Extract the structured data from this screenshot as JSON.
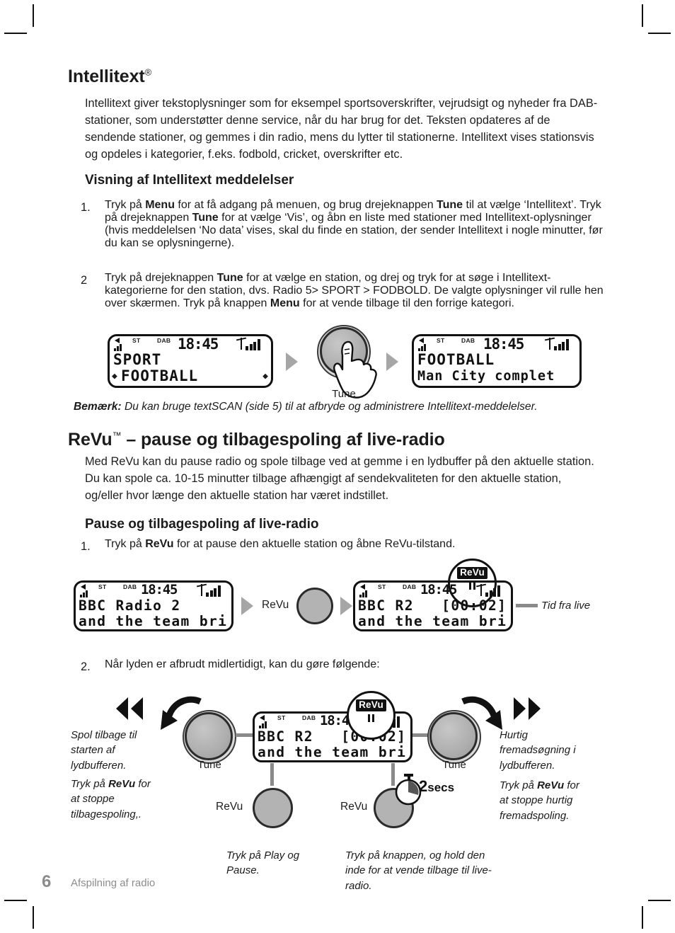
{
  "section1": {
    "title": "Intellitext",
    "title_sup": "®",
    "intro": "Intellitext giver tekstoplysninger som for eksempel sportsoverskrifter, vejrudsigt og nyheder fra DAB-stationer, som understøtter denne service, når du har brug for det. Teksten opdateres af de sendende stationer, og gemmes i din radio, mens du lytter til stationerne. Intellitext vises stationsvis og opdeles i kategorier, f.eks. fodbold, cricket, overskrifter etc.",
    "subtitle": "Visning af Intellitext meddelelser",
    "steps": [
      {
        "num": "1.",
        "parts": [
          {
            "t": "Tryk på ",
            "b": false
          },
          {
            "t": "Menu",
            "b": true
          },
          {
            "t": " for at få adgang på menuen, og brug drejeknappen ",
            "b": false
          },
          {
            "t": "Tune",
            "b": true
          },
          {
            "t": " til at vælge ‘Intellitext’. Tryk på drejeknappen ",
            "b": false
          },
          {
            "t": "Tune",
            "b": true
          },
          {
            "t": " for at vælge ‘Vis’, og åbn en liste med stationer med Intellitext-oplysninger (hvis meddelelsen ‘No data’ vises, skal du finde en station, der sender Intellitext i nogle minutter, før du kan se oplysningerne).",
            "b": false
          }
        ]
      },
      {
        "num": "2",
        "parts": [
          {
            "t": "Tryk på drejeknappen ",
            "b": false
          },
          {
            "t": "Tune",
            "b": true
          },
          {
            "t": " for at vælge en station, og drej og tryk for at søge i Intellitext-kategorierne for den station, dvs. Radio 5> SPORT > FODBOLD. De valgte oplysninger vil rulle hen over skærmen. Tryk på knappen ",
            "b": false
          },
          {
            "t": "Menu",
            "b": true
          },
          {
            "t": " for at vende tilbage til den forrige kategori.",
            "b": false
          }
        ]
      }
    ],
    "note_label": "Bemærk:",
    "note_text": " Du kan bruge textSCAN (side 5) til at afbryde og administrere Intellitext-meddelelser."
  },
  "diagram1": {
    "lcd_left": {
      "st": "ST",
      "dab": "DAB",
      "clock": "18:45",
      "line1": "SPORT",
      "line2": "FOOTBALL",
      "scroll_left": "◆",
      "scroll_right": "◆"
    },
    "lcd_right": {
      "st": "ST",
      "dab": "DAB",
      "clock": "18:45",
      "line1": "FOOTBALL",
      "line2": "Man City complet"
    },
    "knob_label": "Tune"
  },
  "section2": {
    "title": "ReVu",
    "title_sup": "™",
    "title_rest": " – pause og tilbagespoling af live-radio",
    "intro": "Med ReVu kan du pause radio og spole tilbage ved at gemme i en lydbuffer på den aktuelle station. Du kan spole ca. 10-15 minutter tilbage afhængigt af sendekvaliteten for den aktuelle station, og/eller hvor længe den aktuelle station har været indstillet.",
    "subtitle": "Pause og tilbagespoling af live-radio",
    "step1": {
      "num": "1.",
      "parts": [
        {
          "t": "Tryk på ",
          "b": false
        },
        {
          "t": "ReVu",
          "b": true
        },
        {
          "t": " for at pause den aktuelle station og åbne ReVu-tilstand.",
          "b": false
        }
      ]
    },
    "step2": {
      "num": "2.",
      "text": "Når lyden er afbrudt midlertidigt, kan du gøre følgende:"
    }
  },
  "diagram2": {
    "lcd_left": {
      "st": "ST",
      "dab": "DAB",
      "clock": "18:45",
      "line1": "BBC Radio 2",
      "line2": "and the team bri"
    },
    "lcd_right": {
      "st": "ST",
      "dab": "DAB",
      "clock": "18:45",
      "line1": "BBC R2   [00:02]",
      "line2": "and the team bri"
    },
    "revu_button_label": "ReVu",
    "revu_badge_text": "ReVu",
    "callout": "Tid fra live"
  },
  "diagram3": {
    "lcd": {
      "st": "ST",
      "dab": "DAB",
      "clock": "18:45",
      "line1": "BBC R2   [00:02]",
      "line2": "and the team bri"
    },
    "revu_badge_text": "ReVu",
    "left_knob_label": "Tune",
    "right_knob_label": "Tune",
    "left_caption_1": "Spol tilbage til starten af lydbufferen.",
    "left_caption_2_parts": [
      {
        "t": "Tryk på ",
        "b": false
      },
      {
        "t": "ReVu",
        "b": true
      },
      {
        "t": " for at stoppe tilbagespoling,.",
        "b": false
      }
    ],
    "right_caption_1": "Hurtig fremadsøgning i lydbufferen.",
    "right_caption_2_parts": [
      {
        "t": "Tryk på ",
        "b": false
      },
      {
        "t": "ReVu",
        "b": true
      },
      {
        "t": " for at stoppe hurtig fremadspoling.",
        "b": false
      }
    ],
    "center_left_button_label": "ReVu",
    "center_left_caption": "Tryk på Play og Pause.",
    "center_right_button_label": "ReVu",
    "center_right_caption": "Tryk på knappen, og hold den inde for at vende tilbage til live-radio.",
    "stopwatch_value": "2",
    "stopwatch_unit": "secs"
  },
  "footer": {
    "page_number": "6",
    "text": "Afspilning af radio"
  },
  "colors": {
    "text": "#1b1b1b",
    "footer": "#8c8c8c",
    "knob_fill": "#b3b3b3",
    "arrow_gray": "#a6a6a6",
    "connector": "#8a8a8a"
  }
}
